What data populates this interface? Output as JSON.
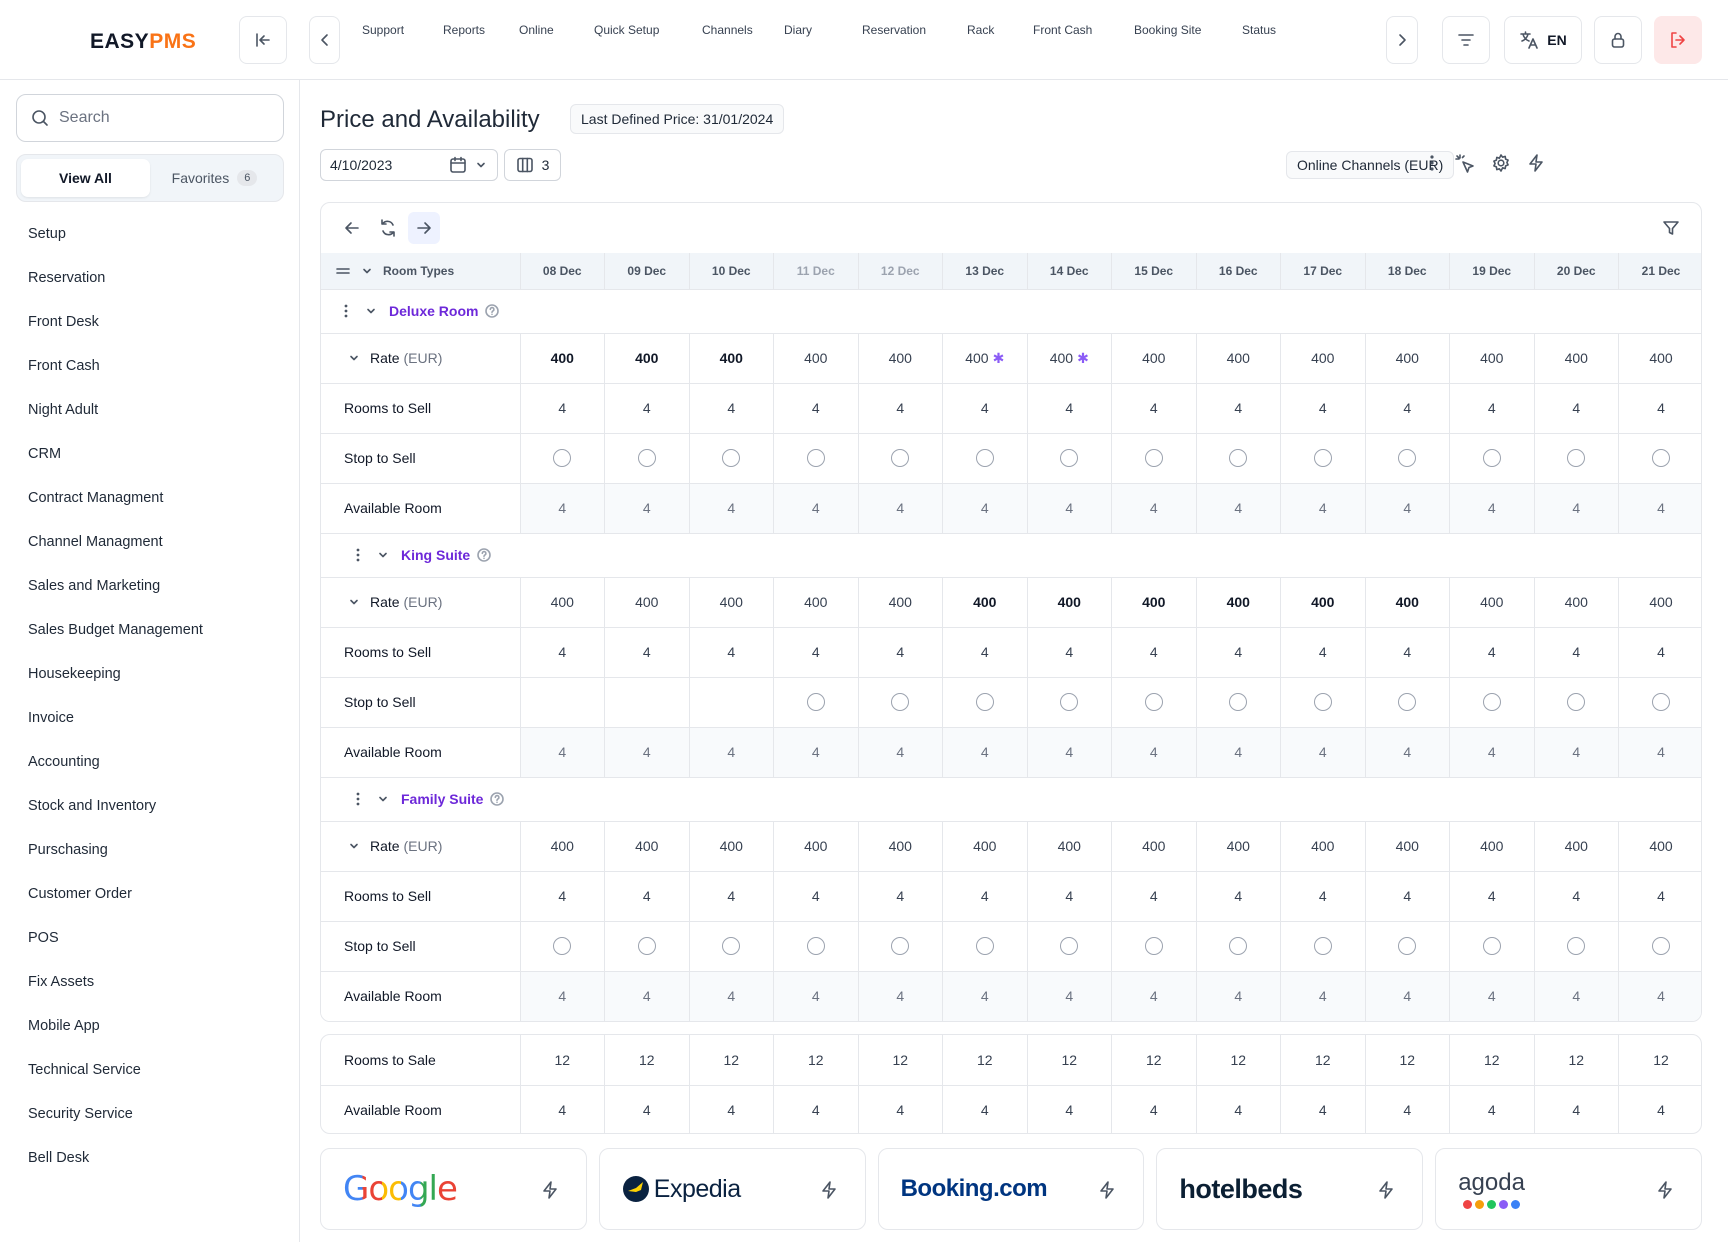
{
  "header": {
    "logo_easy": "EASY",
    "logo_pms": "PMS",
    "nav": [
      {
        "label": "Support",
        "icon": "support-icon"
      },
      {
        "label": "Reports",
        "icon": "reports-icon"
      },
      {
        "label": "Online",
        "icon": "monitor-icon"
      },
      {
        "label": "Quick Setup",
        "icon": "fast-forward-icon"
      },
      {
        "label": "Channels",
        "icon": "glasses-icon"
      },
      {
        "label": "Diary",
        "icon": "calendar-icon"
      },
      {
        "label": "Reservation",
        "icon": "plane-icon"
      },
      {
        "label": "Rack",
        "icon": "grid-icon"
      },
      {
        "label": "Front Cash",
        "icon": "cash-icon"
      },
      {
        "label": "Booking Site",
        "icon": "bookmark-icon"
      },
      {
        "label": "Status",
        "icon": "gauge-icon"
      }
    ],
    "language": "EN"
  },
  "sidebar": {
    "search_placeholder": "Search",
    "tabs": {
      "view_all": "View All",
      "favorites": "Favorites",
      "favorites_count": "6"
    },
    "items": [
      {
        "label": "Setup"
      },
      {
        "label": "Reservation"
      },
      {
        "label": "Front Desk"
      },
      {
        "label": "Front Cash"
      },
      {
        "label": "Night Adult"
      },
      {
        "label": "CRM"
      },
      {
        "label": "Contract Managment"
      },
      {
        "label": "Channel Managment"
      },
      {
        "label": "Sales and Marketing"
      },
      {
        "label": "Sales Budget Management"
      },
      {
        "label": "Housekeeping"
      },
      {
        "label": "Invoice"
      },
      {
        "label": "Accounting"
      },
      {
        "label": "Stock and Inventory"
      },
      {
        "label": "Purschasing"
      },
      {
        "label": "Customer Order"
      },
      {
        "label": "POS"
      },
      {
        "label": "Fix Assets"
      },
      {
        "label": "Mobile App"
      },
      {
        "label": "Technical Service"
      },
      {
        "label": "Security Service"
      },
      {
        "label": "Bell Desk"
      }
    ]
  },
  "page": {
    "title": "Price and Availability",
    "last_defined_price": "Last Defined Price: 31/01/2024",
    "date": "4/10/2023",
    "columns": "3",
    "channel_select": "Online Channels (EUR)"
  },
  "grid": {
    "room_types_label": "Room Types",
    "dates": [
      "08 Dec",
      "09 Dec",
      "10 Dec",
      "11 Dec",
      "12 Dec",
      "13 Dec",
      "14 Dec",
      "15 Dec",
      "16 Dec",
      "17 Dec",
      "18 Dec",
      "19 Dec",
      "20 Dec",
      "21 Dec"
    ],
    "dim_dates": [
      3,
      4
    ],
    "row_labels": {
      "rate": "Rate",
      "currency": "(EUR)",
      "rooms_to_sell": "Rooms to Sell",
      "stop_to_sell": "Stop to Sell",
      "available_room": "Available Room"
    },
    "rooms": [
      {
        "name": "Deluxe Room",
        "rates": [
          "400",
          "400",
          "400",
          "400",
          "400",
          "400",
          "400",
          "400",
          "400",
          "400",
          "400",
          "400",
          "400",
          "400"
        ],
        "rate_bold": [
          0,
          1,
          2
        ],
        "rate_star": [
          5,
          6
        ],
        "rooms_to_sell": [
          "4",
          "4",
          "4",
          "4",
          "4",
          "4",
          "4",
          "4",
          "4",
          "4",
          "4",
          "4",
          "4",
          "4"
        ],
        "stop_radio": [
          0,
          1,
          2,
          3,
          4,
          5,
          6,
          7,
          8,
          9,
          10,
          11,
          12,
          13
        ],
        "available": [
          "4",
          "4",
          "4",
          "4",
          "4",
          "4",
          "4",
          "4",
          "4",
          "4",
          "4",
          "4",
          "4",
          "4"
        ]
      },
      {
        "name": "King Suite",
        "rates": [
          "400",
          "400",
          "400",
          "400",
          "400",
          "400",
          "400",
          "400",
          "400",
          "400",
          "400",
          "400",
          "400",
          "400"
        ],
        "rate_bold": [
          5,
          6,
          7,
          8,
          9,
          10
        ],
        "rate_star": [],
        "rooms_to_sell": [
          "4",
          "4",
          "4",
          "4",
          "4",
          "4",
          "4",
          "4",
          "4",
          "4",
          "4",
          "4",
          "4",
          "4"
        ],
        "stop_radio": [
          3,
          4,
          5,
          6,
          7,
          8,
          9,
          10,
          11,
          12,
          13
        ],
        "available": [
          "4",
          "4",
          "4",
          "4",
          "4",
          "4",
          "4",
          "4",
          "4",
          "4",
          "4",
          "4",
          "4",
          "4"
        ]
      },
      {
        "name": "Family Suite",
        "rates": [
          "400",
          "400",
          "400",
          "400",
          "400",
          "400",
          "400",
          "400",
          "400",
          "400",
          "400",
          "400",
          "400",
          "400"
        ],
        "rate_bold": [],
        "rate_star": [],
        "rooms_to_sell": [
          "4",
          "4",
          "4",
          "4",
          "4",
          "4",
          "4",
          "4",
          "4",
          "4",
          "4",
          "4",
          "4",
          "4"
        ],
        "stop_radio": [
          0,
          1,
          2,
          3,
          4,
          5,
          6,
          7,
          8,
          9,
          10,
          11,
          12,
          13
        ],
        "available": [
          "4",
          "4",
          "4",
          "4",
          "4",
          "4",
          "4",
          "4",
          "4",
          "4",
          "4",
          "4",
          "4",
          "4"
        ]
      }
    ]
  },
  "totals": {
    "rooms_to_sale_label": "Rooms to Sale",
    "rooms_to_sale": [
      "12",
      "12",
      "12",
      "12",
      "12",
      "12",
      "12",
      "12",
      "12",
      "12",
      "12",
      "12",
      "12",
      "12"
    ],
    "available_label": "Available Room",
    "available": [
      "4",
      "4",
      "4",
      "4",
      "4",
      "4",
      "4",
      "4",
      "4",
      "4",
      "4",
      "4",
      "4",
      "4"
    ]
  },
  "channels": [
    {
      "name": "Google",
      "logo": "google-logo"
    },
    {
      "name": "Expedia",
      "logo": "expedia-logo"
    },
    {
      "name": "Booking.com",
      "logo": "booking-logo"
    },
    {
      "name": "hotelbeds",
      "logo": "hotelbeds-logo"
    },
    {
      "name": "agoda",
      "logo": "agoda-logo"
    }
  ],
  "colors": {
    "accent": "#6d28d9",
    "logo_orange": "#f97316",
    "logout_bg": "#fde8e8",
    "logout_icon": "#ef4444"
  }
}
